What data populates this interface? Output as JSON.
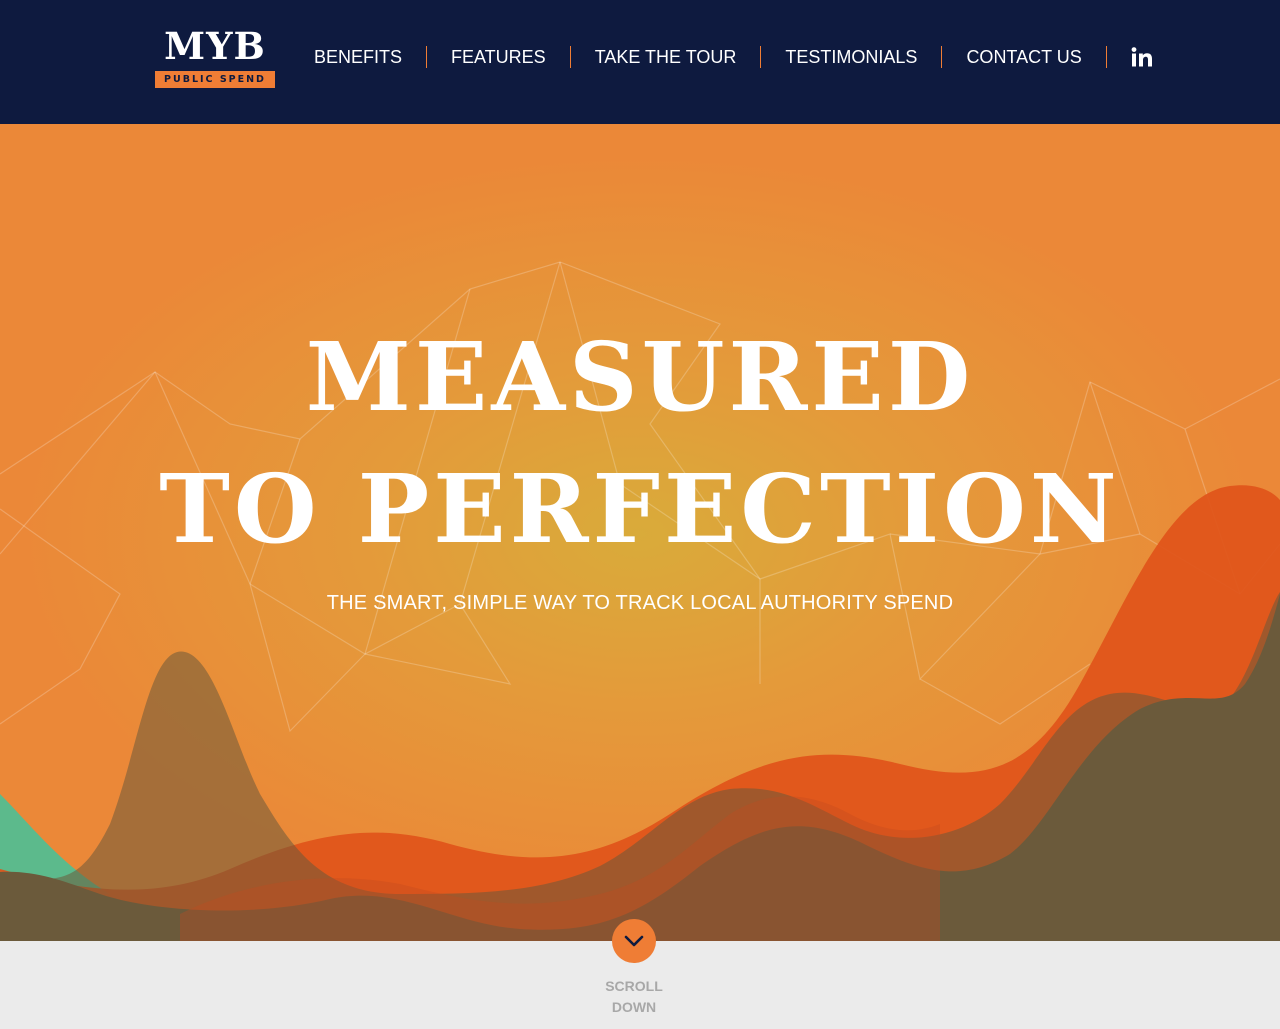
{
  "logo": {
    "wordmark": "MYB",
    "tagline": "PUBLIC SPEND"
  },
  "nav": {
    "items": [
      {
        "label": "BENEFITS"
      },
      {
        "label": "FEATURES"
      },
      {
        "label": "TAKE THE TOUR"
      },
      {
        "label": "TESTIMONIALS"
      },
      {
        "label": "CONTACT US"
      }
    ],
    "social_icon": "linkedin-icon"
  },
  "hero": {
    "title_line1": "MEASURED",
    "title_line2": "TO PERFECTION",
    "subtitle": "THE SMART, SIMPLE WAY TO TRACK LOCAL AUTHORITY SPEND"
  },
  "scroll": {
    "line1": "SCROLL",
    "line2": "DOWN",
    "icon": "chevron-down-icon"
  },
  "colors": {
    "navy": "#0e1a3f",
    "accent_orange": "#ef7d35",
    "hero_orange": "#eb8838",
    "wave_red": "#e0541a",
    "wave_brown": "#6b5a3b",
    "wave_green": "#5cba8c",
    "footer_grey": "#ebebeb"
  }
}
